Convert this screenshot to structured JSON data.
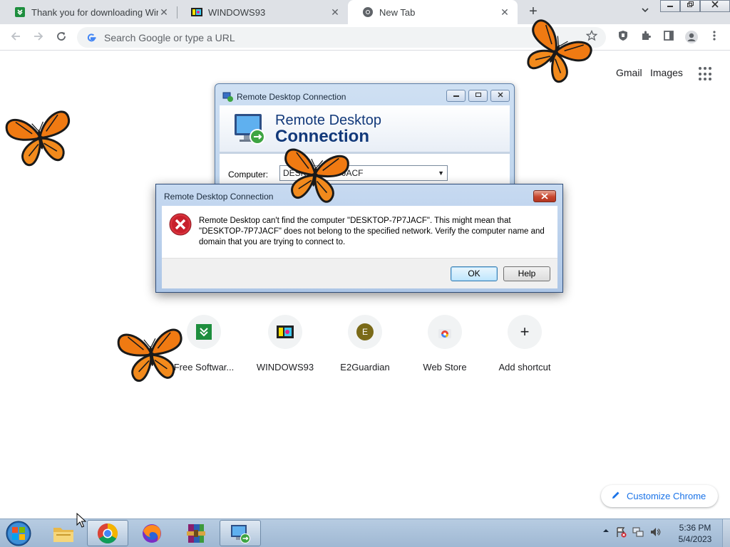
{
  "browser": {
    "tabs": [
      {
        "title": "Thank you for downloading WinR",
        "favicon": "green-download-icon"
      },
      {
        "title": "WINDOWS93",
        "favicon": "windows93-icon"
      },
      {
        "title": "New Tab",
        "favicon": "chrome-icon"
      }
    ],
    "close_glyph": "✕",
    "newtab_glyph": "+",
    "omnibox": {
      "placeholder": "Search Google or type a URL"
    }
  },
  "ntp": {
    "header_links": [
      "Gmail",
      "Images"
    ],
    "tiles": [
      {
        "label": "Free Softwar...",
        "icon": "green-download-icon"
      },
      {
        "label": "WINDOWS93",
        "icon": "windows93-icon"
      },
      {
        "label": "E2Guardian",
        "icon": "letter-e-icon",
        "letter": "E"
      },
      {
        "label": "Web Store",
        "icon": "web-store-icon"
      },
      {
        "label": "Add shortcut",
        "icon": "plus-icon",
        "glyph": "+"
      }
    ],
    "customize_label": "Customize Chrome"
  },
  "rdc_window": {
    "title": "Remote Desktop Connection",
    "heading_line1": "Remote Desktop",
    "heading_line2": "Connection",
    "computer_label": "Computer:",
    "computer_value": "DESKTOP-7P7JACF"
  },
  "error_dialog": {
    "title": "Remote Desktop Connection",
    "message": "Remote Desktop can't find the computer \"DESKTOP-7P7JACF\". This might mean that \"DESKTOP-7P7JACF\" does not belong to the specified network.  Verify the computer name and domain that you are trying to connect to.",
    "ok_label": "OK",
    "help_label": "Help"
  },
  "taskbar": {
    "time": "5:36 PM",
    "date": "5/4/2023",
    "items": [
      "start-orb",
      "file-explorer",
      "chrome",
      "firefox",
      "winrar",
      "remote-desktop"
    ]
  },
  "colors": {
    "accent": "#1a73e8",
    "error_red": "#c8202c",
    "butterfly_orange": "#f07a12"
  }
}
